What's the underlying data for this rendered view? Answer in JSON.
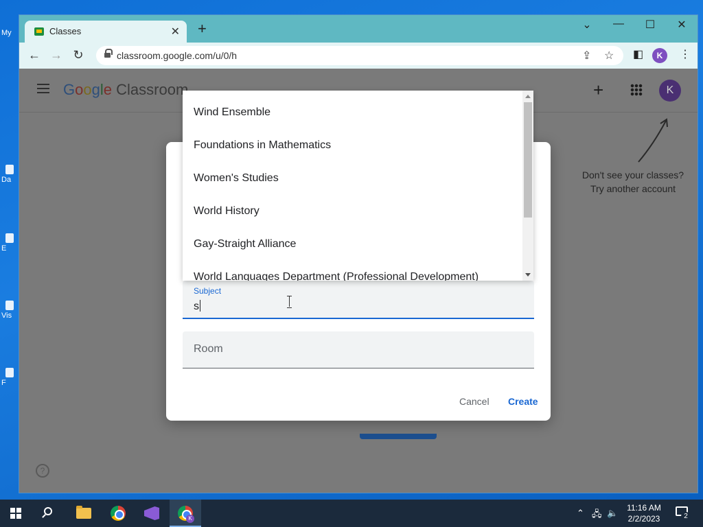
{
  "desktop": {
    "icon_labels": [
      "My",
      "Da",
      "E",
      "Vis",
      "F"
    ]
  },
  "browser": {
    "tab_title": "Classes",
    "new_tab_symbol": "+",
    "url": "classroom.google.com/u/0/h",
    "profile_initial": "K",
    "window_controls": [
      "chevron-down",
      "minimize",
      "maximize",
      "close"
    ]
  },
  "classroom": {
    "logo_google": [
      "G",
      "o",
      "o",
      "g",
      "l",
      "e"
    ],
    "logo_product": "Classroom",
    "avatar_initial": "K",
    "hint_line1": "Don't see your classes?",
    "hint_line2": "Try another account"
  },
  "dialog": {
    "subject_label": "Subject",
    "subject_value": "s",
    "room_placeholder": "Room",
    "cancel_label": "Cancel",
    "create_label": "Create"
  },
  "autocomplete": {
    "options": [
      "Wind Ensemble",
      "Foundations in Mathematics",
      "Women's Studies",
      "World History",
      "Gay-Straight Alliance",
      "World Languages Department (Professional Development)"
    ]
  },
  "taskbar": {
    "time": "11:16 AM",
    "date": "2/2/2023",
    "notification_count": "2"
  },
  "colors": {
    "accent": "#1967d2",
    "tabbar": "#5fb8c2",
    "avatar": "#7e4fc0"
  }
}
